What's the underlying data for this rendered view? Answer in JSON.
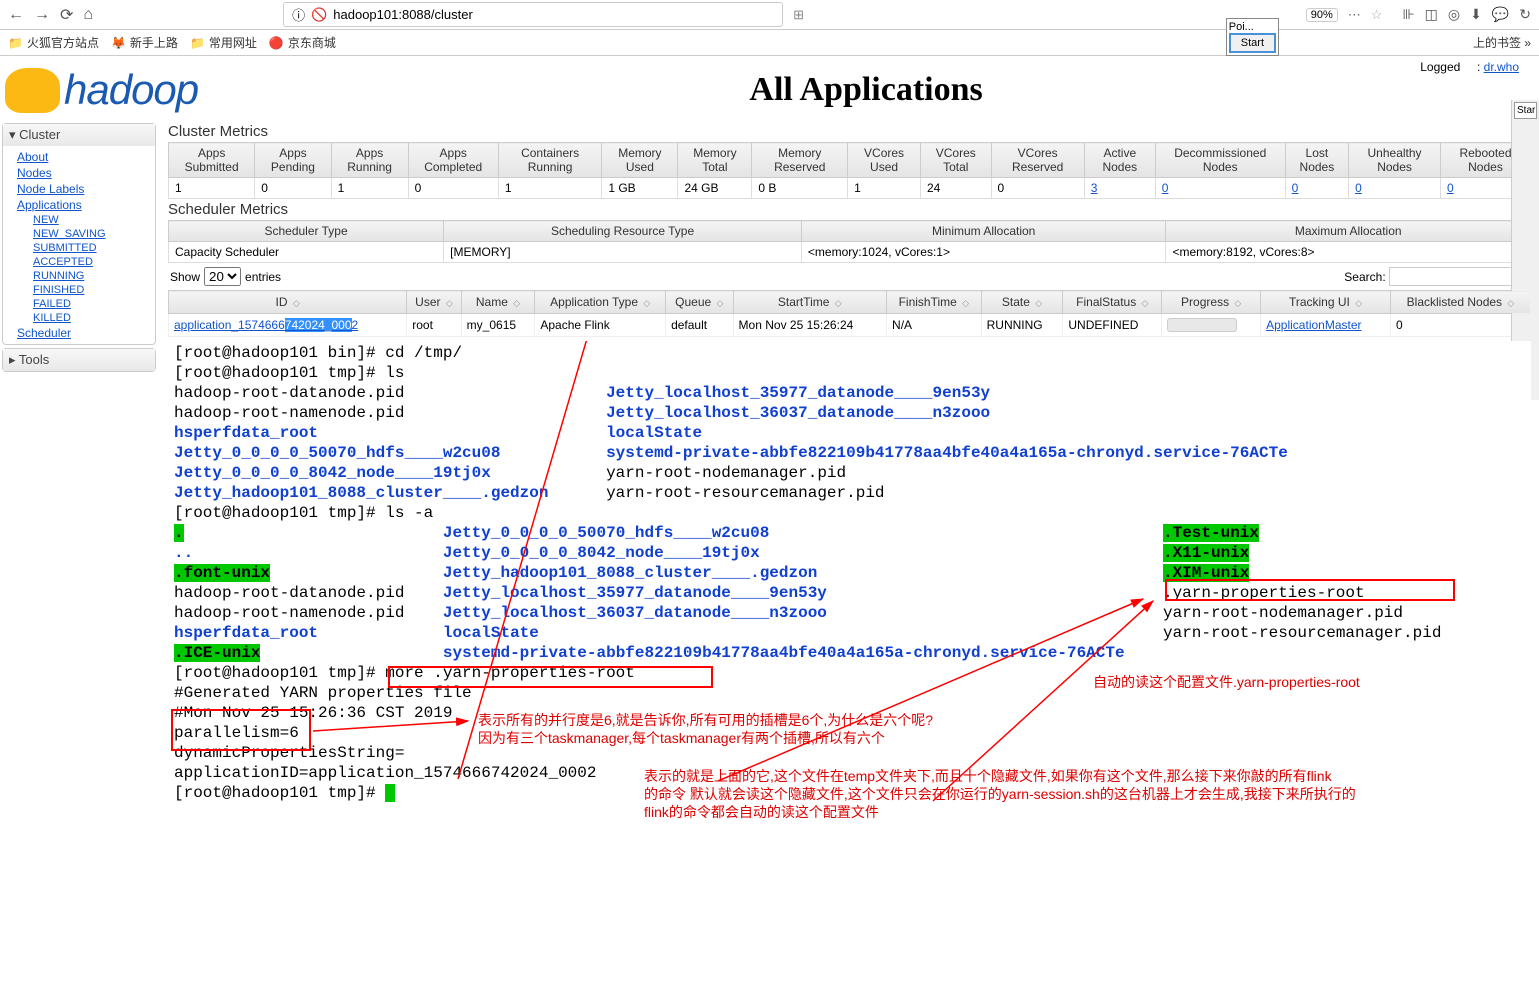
{
  "browser": {
    "url": "hadoop101:8088/cluster",
    "zoom": "90%",
    "bookmarks": [
      "火狐官方站点",
      "新手上路",
      "常用网址",
      "京东商城"
    ],
    "floating_label": "Poi...",
    "start_btn": "Start",
    "logged_in_prefix": "Logged",
    "logged_in_user": "dr.who",
    "right_tab": "Star"
  },
  "page": {
    "logo_text": "hadoop",
    "title": "All Applications"
  },
  "sidebar": {
    "cluster_header": "Cluster",
    "cluster_links": [
      "About",
      "Nodes",
      "Node Labels",
      "Applications"
    ],
    "app_states": [
      "NEW",
      "NEW_SAVING",
      "SUBMITTED",
      "ACCEPTED",
      "RUNNING",
      "FINISHED",
      "FAILED",
      "KILLED"
    ],
    "scheduler": "Scheduler",
    "tools_header": "Tools"
  },
  "metrics": {
    "cluster_title": "Cluster Metrics",
    "headers": [
      "Apps Submitted",
      "Apps Pending",
      "Apps Running",
      "Apps Completed",
      "Containers Running",
      "Memory Used",
      "Memory Total",
      "Memory Reserved",
      "VCores Used",
      "VCores Total",
      "VCores Reserved",
      "Active Nodes",
      "Decommissioned Nodes",
      "Lost Nodes",
      "Unhealthy Nodes",
      "Rebooted Nodes"
    ],
    "values": [
      "1",
      "0",
      "1",
      "0",
      "1",
      "1 GB",
      "24 GB",
      "0 B",
      "1",
      "24",
      "0",
      "3",
      "0",
      "0",
      "0",
      "0"
    ],
    "scheduler_title": "Scheduler Metrics",
    "sched_headers": [
      "Scheduler Type",
      "Scheduling Resource Type",
      "Minimum Allocation",
      "Maximum Allocation"
    ],
    "sched_values": [
      "Capacity Scheduler",
      "[MEMORY]",
      "<memory:1024, vCores:1>",
      "<memory:8192, vCores:8>"
    ]
  },
  "apps": {
    "show_label": "Show",
    "show_count": "20",
    "entries_label": "entries",
    "search_label": "Search:",
    "headers": [
      "ID",
      "User",
      "Name",
      "Application Type",
      "Queue",
      "StartTime",
      "FinishTime",
      "State",
      "FinalStatus",
      "Progress",
      "Tracking UI",
      "Blacklisted Nodes"
    ],
    "row": {
      "id_prefix": "application_1574666",
      "id_highlight": "742024_000",
      "id_suffix": "2",
      "user": "root",
      "name": "my_0615",
      "type": "Apache Flink",
      "queue": "default",
      "start": "Mon Nov 25 15:26:24",
      "finish": "N/A",
      "state": "RUNNING",
      "final": "UNDEFINED",
      "tracking": "ApplicationMaster",
      "blacklisted": "0"
    }
  },
  "terminal": {
    "l1": "[root@hadoop101 bin]# cd /tmp/",
    "l2": "[root@hadoop101 tmp]# ls",
    "l3a": "hadoop-root-datanode.pid",
    "l3b": "Jetty_localhost_35977_datanode____9en53y",
    "l4a": "hadoop-root-namenode.pid",
    "l4b": "Jetty_localhost_36037_datanode____n3zooo",
    "l5a": "hsperfdata_root",
    "l5b": "localState",
    "l6a": "Jetty_0_0_0_0_50070_hdfs____w2cu08",
    "l6b": "systemd-private-abbfe822109b41778aa4bfe40a4a165a-chronyd.service-76ACTe",
    "l7a": "Jetty_0_0_0_0_8042_node____19tj0x",
    "l7b": "yarn-root-nodemanager.pid",
    "l8a": "Jetty_hadoop101_8088_cluster____.gedzon",
    "l8b": "yarn-root-resourcemanager.pid",
    "l9": "[root@hadoop101 tmp]# ls -a",
    "l10a": ".",
    "l10b": "Jetty_0_0_0_0_50070_hdfs____w2cu08",
    "l10c": ".Test-unix",
    "l11a": "..",
    "l11b": "Jetty_0_0_0_0_8042_node____19tj0x",
    "l11c": ".X11-unix",
    "l12a": ".font-unix",
    "l12b": "Jetty_hadoop101_8088_cluster____.gedzon",
    "l12c": ".XIM-unix",
    "l13a": "hadoop-root-datanode.pid",
    "l13b": "Jetty_localhost_35977_datanode____9en53y",
    "l13c": ".yarn-properties-root",
    "l14a": "hadoop-root-namenode.pid",
    "l14b": "Jetty_localhost_36037_datanode____n3zooo",
    "l14c": "yarn-root-nodemanager.pid",
    "l15a": "hsperfdata_root",
    "l15b": "localState",
    "l15c": "yarn-root-resourcemanager.pid",
    "l16a": ".ICE-unix",
    "l16b": "systemd-private-abbfe822109b41778aa4bfe40a4a165a-chronyd.service-76ACTe",
    "l17": "[root@hadoop101 tmp]# more .yarn-properties-root",
    "l18": "#Generated YARN properties file",
    "l19": "#Mon Nov 25 15:26:36 CST 2019",
    "l20": "parallelism=6",
    "l21": "dynamicPropertiesString=",
    "l22": "applicationID=application_1574666742024_0002",
    "l23": "[root@hadoop101 tmp]# "
  },
  "annotations": {
    "a1": "表示所有的并行度是6,就是告诉你,所有可用的插槽是6个,为什么是六个呢?",
    "a1b": "因为有三个taskmanager,每个taskmanager有两个插槽,所以有六个",
    "a2": "自动的读这个配置文件.yarn-properties-root",
    "a3a": "表示的就是上面的它,这个文件在temp文件夹下,而且十个隐藏文件,如果你有这个文件,那么接下来你敲的所有flink",
    "a3b": "的命令 默认就会读这个隐藏文件,这个文件只会在你运行的yarn-session.sh的这台机器上才会生成,我接下来所执行的",
    "a3c": "flink的命令都会自动的读这个配置文件"
  }
}
